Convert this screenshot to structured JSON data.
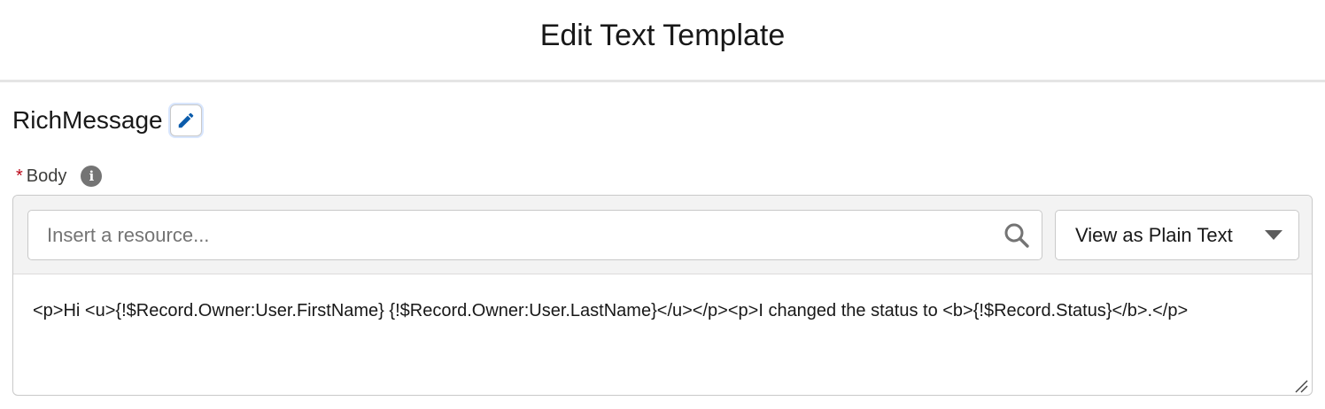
{
  "header": {
    "title": "Edit Text Template"
  },
  "template": {
    "name": "RichMessage",
    "edit_icon": "pencil-icon"
  },
  "body_field": {
    "required_marker": "*",
    "label": "Body",
    "info_icon": "info-icon",
    "info_glyph": "i"
  },
  "toolbar": {
    "resource_search": {
      "placeholder": "Insert a resource...",
      "value": "",
      "icon": "search-icon"
    },
    "view_mode": {
      "selected": "View as Plain Text",
      "icon": "chevron-down-icon"
    }
  },
  "editor": {
    "content": "<p>Hi <u>{!$Record.Owner:User.FirstName} {!$Record.Owner:User.LastName}</u></p><p>I changed the status to <b>{!$Record.Status}</b>.</p>"
  },
  "colors": {
    "required": "#ba0517",
    "toolbar_bg": "#f3f3f3",
    "edit_icon": "#0b5cab",
    "border": "#c9c9c9"
  }
}
